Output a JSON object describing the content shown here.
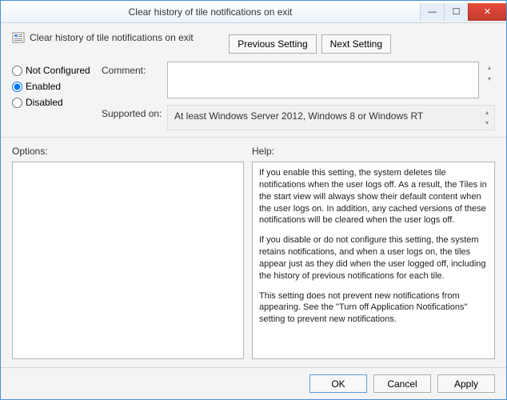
{
  "window": {
    "title": "Clear history of tile notifications on exit"
  },
  "header": {
    "policy_name": "Clear history of tile notifications on exit",
    "prev_btn": "Previous Setting",
    "next_btn": "Next Setting"
  },
  "state": {
    "options": {
      "not_configured": "Not Configured",
      "enabled": "Enabled",
      "disabled": "Disabled"
    },
    "selected": "enabled"
  },
  "fields": {
    "comment_label": "Comment:",
    "comment_value": "",
    "supported_label": "Supported on:",
    "supported_value": "At least Windows Server 2012, Windows 8 or Windows RT"
  },
  "panels": {
    "options_label": "Options:",
    "help_label": "Help:",
    "help_paragraphs": [
      "If you enable this setting, the system deletes tile notifications when the user logs off. As a result, the Tiles in the start view will always show their default content when the user logs on. In addition, any cached versions of these notifications will be cleared when the user logs off.",
      "If you disable or do not configure this setting, the system retains notifications, and when a user logs on, the tiles appear just as they did when the user logged off, including the history of previous notifications for each tile.",
      "This setting does not prevent new notifications from appearing. See the \"Turn off Application Notifications\" setting to prevent new notifications."
    ]
  },
  "footer": {
    "ok": "OK",
    "cancel": "Cancel",
    "apply": "Apply"
  }
}
